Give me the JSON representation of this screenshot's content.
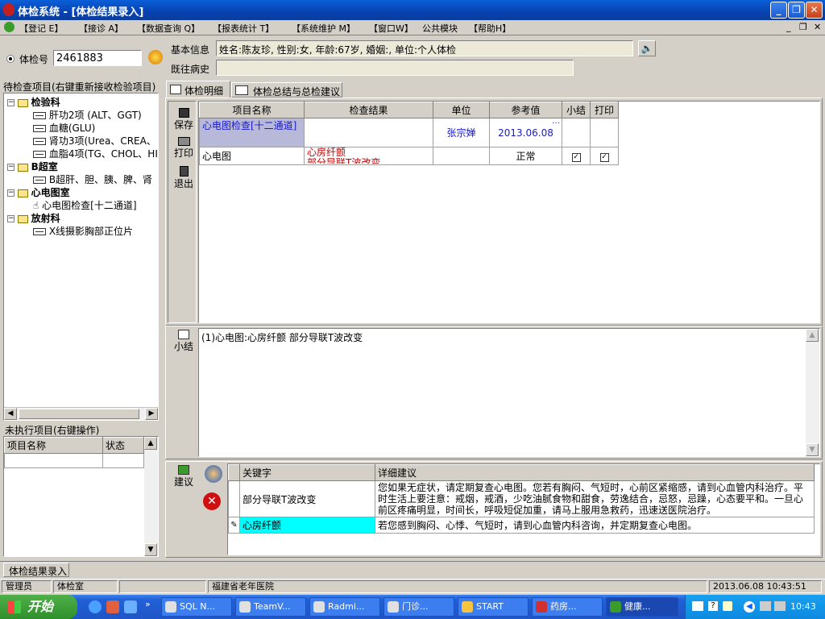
{
  "window": {
    "title": "体检系统 - [体检结果录入]"
  },
  "menu": [
    "【登记 E】",
    "【接诊 A】",
    "【数据查询 Q】",
    "【报表统计 T】",
    "【系统维护 M】",
    "【窗口W】",
    "公共模块",
    "【帮助H】"
  ],
  "exam": {
    "radio_label": "体检号",
    "number": "2461883"
  },
  "basic_info": {
    "label": "基本信息",
    "value": "姓名:陈友珍, 性别:女, 年龄:67岁, 婚姻:, 单位:个人体检"
  },
  "history": {
    "label": "既往病史",
    "value": ""
  },
  "pending_tree": {
    "title": "待检查项目(右键重新接收检验项目)",
    "groups": [
      {
        "name": "检验科",
        "items": [
          "肝功2项 (ALT、GGT)",
          "血糖(GLU)",
          "肾功3项(Urea、CREA、",
          "血脂4项(TG、CHOL、HI"
        ]
      },
      {
        "name": "B超室",
        "items": [
          "B超肝、胆、胰、脾、肾"
        ]
      },
      {
        "name": "心电图室",
        "items": [
          "心电图检查[十二通道]"
        ]
      },
      {
        "name": "放射科",
        "items": [
          "X线摄影胸部正位片"
        ]
      }
    ]
  },
  "unexecuted": {
    "title": "未执行项目(右键操作)",
    "col_name": "项目名称",
    "col_status": "状态"
  },
  "tabs": [
    "体检明细",
    "体检总结与总检建议"
  ],
  "side_buttons": {
    "save": "保存",
    "print": "打印",
    "exit": "退出"
  },
  "detail_table": {
    "headers": [
      "项目名称",
      "检查结果",
      "单位",
      "参考值",
      "小结",
      "打印"
    ],
    "rows": [
      {
        "name": "心电图检查[十二通道]",
        "result": "",
        "unit": "张宗婵",
        "ref": "2013.06.08",
        "summary": "",
        "print": ""
      },
      {
        "name": "心电图",
        "result": "心房纤颤\n部分导联T波改变",
        "unit": "",
        "ref": "正常",
        "summary": "✓",
        "print": "✓"
      }
    ]
  },
  "summary": {
    "label": "小结",
    "text": "(1)心电图:心房纤颤 部分导联T波改变"
  },
  "advice": {
    "label": "建议",
    "headers": [
      "关键字",
      "详细建议"
    ],
    "rows": [
      {
        "key": "部分导联T波改变",
        "detail": "您如果无症状，请定期复查心电图。您若有胸闷、气短时，心前区紧缩感，请到心血管内科治疗。平时生活上要注意：戒烟，戒酒，少吃油腻食物和甜食，劳逸结合，忌怒，忌躁，心态要平和。一旦心前区疼痛明显，时间长，呼吸短促加重，请马上服用急救药，迅速送医院治疗。"
      },
      {
        "key": "心房纤颤",
        "detail": "若您感到胸闷、心悸、气短时，请到心血管内科咨询，并定期复查心电图。"
      }
    ]
  },
  "bottom_tab": "体检结果录入",
  "status": {
    "user": "管理员",
    "dept": "体检室",
    "hospital": "福建省老年医院",
    "datetime": "2013.06.08 10:43:51"
  },
  "taskbar": {
    "start": "开始",
    "buttons": [
      "SQL N...",
      "TeamV...",
      "Radmi...",
      "门诊...",
      "START",
      "药房...",
      "健康..."
    ],
    "clock": "10:43"
  }
}
